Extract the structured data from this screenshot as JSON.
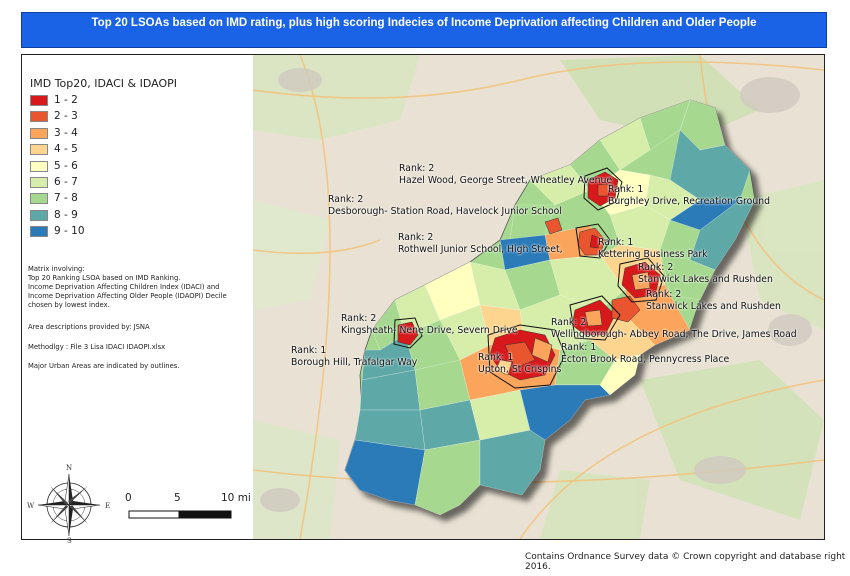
{
  "title": "Top 20 LSOAs based on IMD rating, plus high scoring Indecies of Income Deprivation affecting Children and Older People",
  "legend": {
    "title": "IMD Top20, IDACI & IDAOPI",
    "items": [
      {
        "label": "1 - 2",
        "color": "#d7191c"
      },
      {
        "label": "2 - 3",
        "color": "#e8552f"
      },
      {
        "label": "3 - 4",
        "color": "#fba55c"
      },
      {
        "label": "4 - 5",
        "color": "#fdd58e"
      },
      {
        "label": "5 - 6",
        "color": "#ffffbf"
      },
      {
        "label": "6 - 7",
        "color": "#d6eeaa"
      },
      {
        "label": "7 - 8",
        "color": "#a6d98f"
      },
      {
        "label": "8 - 9",
        "color": "#5fa8a8"
      },
      {
        "label": "9 - 10",
        "color": "#2b7bb9"
      }
    ]
  },
  "notes": {
    "matrix": "Matrix involving:\nTop 20 Ranking LSOA based on IMD Ranking.\nIncome Deprivation Affecting Children Index (IDACI) and\nIncome Deprivation Affecting Older People (IDAOPI) Decile\nchosen by lowest index.",
    "area": "Area descriptions provided by: JSNA",
    "method": "Methodlgy : File 3 Lisa IDACI IDAOPI.xlsx",
    "urban": "Major Urban Areas are indicated by outlines."
  },
  "labels": [
    {
      "rank": "Rank:  2",
      "place": "Hazel Wood, George Street, Wheatley Avenue"
    },
    {
      "rank": "Rank:  1",
      "place": "Burghley Drive, Recreation Ground"
    },
    {
      "rank": "Rank:  2",
      "place": "Desborough- Station Road, Havelock Junior School"
    },
    {
      "rank": "Rank:  2",
      "place": "Rothwell Junior School, High Street,"
    },
    {
      "rank": "Rank:  1",
      "place": "Kettering Business Park"
    },
    {
      "rank": "Rank:  2",
      "place": "Stanwick Lakes and Rushden"
    },
    {
      "rank": "Rank:  2",
      "place": "Stanwick Lakes and Rushden"
    },
    {
      "rank": "Rank:  2",
      "place": "Kingsheath- Nene Drive, Severn Drive"
    },
    {
      "rank": "Rank:  2",
      "place": "Wellingborough- Abbey Road, The Drive, James Road"
    },
    {
      "rank": "Rank:  1",
      "place": "Ecton Brook Road, Pennycress Place"
    },
    {
      "rank": "Rank:  1",
      "place": "Borough Hill, Trafalgar Way"
    },
    {
      "rank": "Rank:  1",
      "place": "Upton, St Crispins"
    }
  ],
  "scale": {
    "t0": "0",
    "t5": "5",
    "t10": "10 mi"
  },
  "compass": {
    "n": "N",
    "s": "S",
    "e": "E",
    "w": "W"
  },
  "credit": "Contains Ordnance Survey data © Crown copyright and database right 2016."
}
